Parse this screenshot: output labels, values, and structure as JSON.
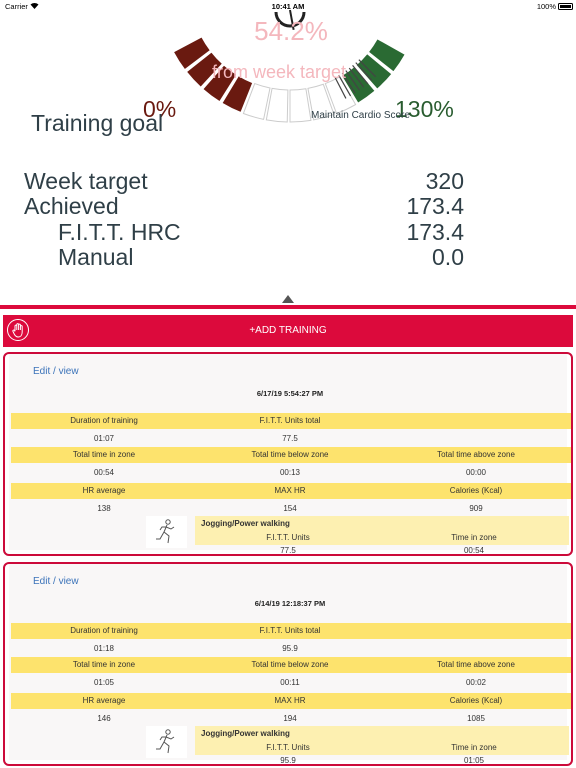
{
  "status_bar": {
    "carrier": "Carrier",
    "time": "10:41 AM",
    "battery": "100%"
  },
  "gauge": {
    "percent": "54.2%",
    "from_target": "from week target",
    "min_label": "0%",
    "max_label": "130%",
    "title": "Training goal",
    "goal_name": "Maintain Cardio Score",
    "progress_fraction": 0.542,
    "colors": {
      "low": "#6a1a10",
      "high": "#2a6a33",
      "accent": "#f4b7bd"
    }
  },
  "summary": [
    {
      "label": "Week target",
      "value": "320"
    },
    {
      "label": "Achieved",
      "value": "173.4"
    },
    {
      "label": "F.I.T.T. HRC",
      "value": "173.4"
    },
    {
      "label": "Manual",
      "value": "0.0"
    }
  ],
  "add_training": {
    "label": "+ADD TRAINING",
    "icon": "hand-icon"
  },
  "trainings": [
    {
      "edit": "Edit / view",
      "datetime": "6/17/19  5:54:27 PM",
      "row1_labels": [
        "Duration of training",
        "F.I.T.T. Units total",
        ""
      ],
      "row1_values": [
        "01:07",
        "77.5",
        ""
      ],
      "row2_labels": [
        "Total time in zone",
        "Total time below zone",
        "Total time above zone"
      ],
      "row2_values": [
        "00:54",
        "00:13",
        "00:00"
      ],
      "row3_labels": [
        "HR average",
        "MAX HR",
        "Calories (Kcal)"
      ],
      "row3_values": [
        "138",
        "154",
        "909"
      ],
      "activity": {
        "name": "Jogging/Power walking",
        "icon": "running-person-icon",
        "labels": [
          "F.I.T.T. Units",
          "Time in zone"
        ],
        "values": [
          "77.5",
          "00:54"
        ]
      }
    },
    {
      "edit": "Edit / view",
      "datetime": "6/14/19  12:18:37 PM",
      "row1_labels": [
        "Duration of training",
        "F.I.T.T. Units total",
        ""
      ],
      "row1_values": [
        "01:18",
        "95.9",
        ""
      ],
      "row2_labels": [
        "Total time in zone",
        "Total time below zone",
        "Total time above zone"
      ],
      "row2_values": [
        "01:05",
        "00:11",
        "00:02"
      ],
      "row3_labels": [
        "HR average",
        "MAX HR",
        "Calories (Kcal)"
      ],
      "row3_values": [
        "146",
        "194",
        "1085"
      ],
      "activity": {
        "name": "Jogging/Power walking",
        "icon": "running-person-icon",
        "labels": [
          "F.I.T.T. Units",
          "Time in zone"
        ],
        "values": [
          "95.9",
          "01:05"
        ]
      }
    }
  ]
}
